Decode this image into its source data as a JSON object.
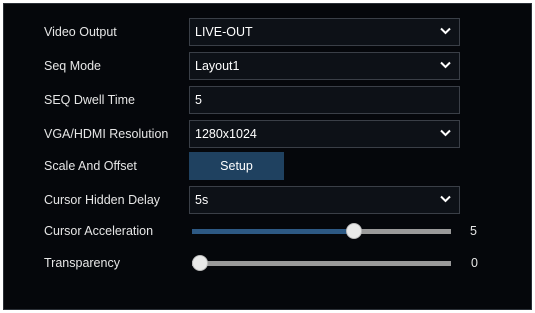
{
  "settings": {
    "video_output": {
      "label": "Video Output",
      "value": "LIVE-OUT"
    },
    "seq_mode": {
      "label": "Seq Mode",
      "value": "Layout1"
    },
    "seq_dwell_time": {
      "label": "SEQ Dwell Time",
      "value": "5"
    },
    "resolution": {
      "label": "VGA/HDMI Resolution",
      "value": "1280x1024"
    },
    "scale_offset": {
      "label": "Scale And Offset",
      "button": "Setup"
    },
    "cursor_hidden_delay": {
      "label": "Cursor Hidden Delay",
      "value": "5s"
    },
    "cursor_acceleration": {
      "label": "Cursor Acceleration",
      "value": "5",
      "min": 0,
      "max": 8
    },
    "transparency": {
      "label": "Transparency",
      "value": "0",
      "min": 0,
      "max": 10
    }
  },
  "colors": {
    "panel_bg": "#05070b",
    "field_border": "#3a3f47",
    "button_bg": "#1f4160",
    "slider_fill": "#2d5984",
    "slider_track": "#9a9a9a"
  },
  "icons": {
    "dropdown": "chevron-down-icon"
  }
}
